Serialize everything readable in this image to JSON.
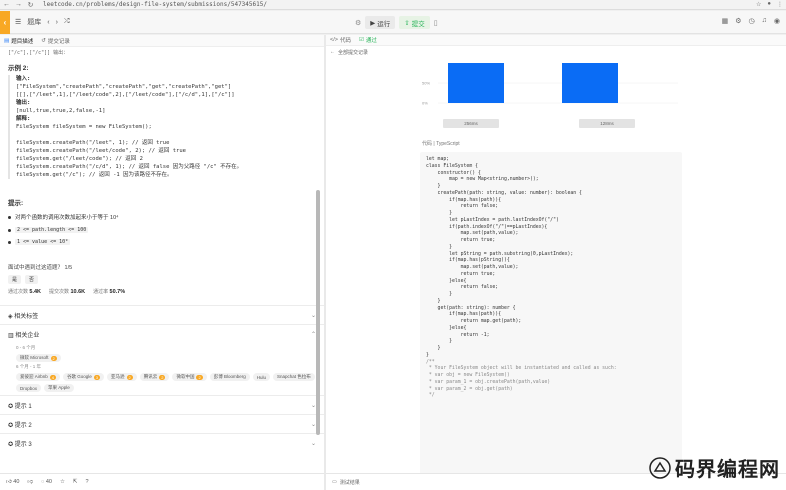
{
  "browser": {
    "url": "leetcode.cn/problems/design-file-system/submissions/547345615/"
  },
  "header": {
    "problem_list": "题库",
    "run_label": "运行",
    "submit_label": "提交"
  },
  "left": {
    "tabs": [
      {
        "label": "题目描述"
      },
      {
        "label": "提交记录"
      }
    ],
    "top_fragment": "[\"/c\"],[\"/c\"]]  输出：",
    "example2": {
      "title": "示例 2:",
      "input_label": "输入:",
      "input_line1": "[\"FileSystem\",\"createPath\",\"createPath\",\"get\",\"createPath\",\"get\"]",
      "input_line2": "[[],[\"/leet\",1],[\"/leet/code\",2],[\"/leet/code\"],[\"/c/d\",1],[\"/c\"]]",
      "output_label": "输出:",
      "output_value": "[null,true,true,2,false,-1]",
      "explain_label": "解释:",
      "explain_lines": [
        "FileSystem fileSystem = new FileSystem();",
        "",
        "fileSystem.createPath(\"/leet\", 1); // 返回 true",
        "fileSystem.createPath(\"/leet/code\", 2); // 返回 true",
        "fileSystem.get(\"/leet/code\"); // 返回 2",
        "fileSystem.createPath(\"/c/d\", 1); // 返回 false 因为父路径 \"/c\" 不存在。",
        "fileSystem.get(\"/c\"); // 返回 -1 因为该路径不存在。"
      ]
    },
    "hints_title": "提示:",
    "hints": [
      "对两个函数的调用次数加起来小于等于 10⁴",
      "2 <= path.length <= 100",
      "1 <= value <= 10⁹"
    ],
    "seen_question": "面试中遇到过这道题？   1/5",
    "yes": "是",
    "no": "否",
    "stats": [
      {
        "label": "通过次数",
        "value": "5.4K"
      },
      {
        "label": "提交次数",
        "value": "10.6K"
      },
      {
        "label": "通过率",
        "value": "50.7%"
      }
    ],
    "sections": {
      "related_topics": "相关标签",
      "related_companies": "相关企业",
      "hint1": "提示 1",
      "hint2": "提示 2",
      "hint3": "提示 3"
    },
    "company_ranges": [
      "0 - 6 个月",
      "6 个月 - 1 年"
    ],
    "company_tags_recent": [
      {
        "name": "微软 Microsoft",
        "count": "2"
      }
    ],
    "company_tags_older": [
      {
        "name": "爱彼迎 Airbnb",
        "count": "4"
      },
      {
        "name": "谷歌 Google",
        "count": "3"
      },
      {
        "name": "亚马逊",
        "count": "2"
      },
      {
        "name": "腾讯云",
        "count": "2"
      },
      {
        "name": "微软中国",
        "count": "2"
      },
      {
        "name": "彭博 Bloomberg",
        "count": ""
      },
      {
        "name": "Hulu",
        "count": ""
      },
      {
        "name": "Snapchat 色拉布",
        "count": ""
      },
      {
        "name": "Dropbox",
        "count": ""
      },
      {
        "name": "苹果 Apple",
        "count": ""
      }
    ],
    "footer": {
      "likes": "40",
      "comments": "40"
    }
  },
  "right": {
    "tabs": [
      {
        "label": "代码"
      },
      {
        "label": "通过"
      }
    ],
    "breadcrumb": "全部提交记录",
    "chart_data": {
      "type": "bar",
      "categories": [
        "",
        ""
      ],
      "values": [
        100,
        100
      ],
      "ylim": [
        0,
        100
      ]
    },
    "chart_ticks": [
      "50%",
      "0%"
    ],
    "pill_labels": [
      "256ms",
      "128ms"
    ],
    "lang_label": "代码 | TypeScript",
    "code_lines": [
      "let map;",
      "class FileSystem {",
      "    constructor() {",
      "        map = new Map<string,number>();",
      "    }",
      "",
      "    createPath(path: string, value: number): boolean {",
      "        if(map.has(path)){",
      "            return false;",
      "        }",
      "        let pLastIndex = path.lastIndexOf(\"/\")",
      "        if(path.indexOf(\"/\")==pLastIndex){",
      "            map.set(path,value);",
      "            return true;",
      "        }",
      "        let pString = path.substring(0,pLastIndex);",
      "        if(map.has(pString)){",
      "            map.set(path,value);",
      "            return true;",
      "        }else{",
      "            return false;",
      "        }",
      "",
      "    }",
      "",
      "    get(path: string): number {",
      "        if(map.has(path)){",
      "            return map.get(path);",
      "        }else{",
      "            return -1;",
      "        }",
      "    }",
      "}",
      "",
      "/**",
      " * Your FileSystem object will be instantiated and called as such:",
      " * var obj = new FileSystem()",
      " * var param_1 = obj.createPath(path,value)",
      " * var param_2 = obj.get(path)",
      " */"
    ],
    "footer_label": "测试结果"
  },
  "watermark": "码界编程网",
  "colors": {
    "brand": "#f8a824",
    "accent_green": "#2db55d",
    "bar_blue": "#0a6cf5"
  }
}
